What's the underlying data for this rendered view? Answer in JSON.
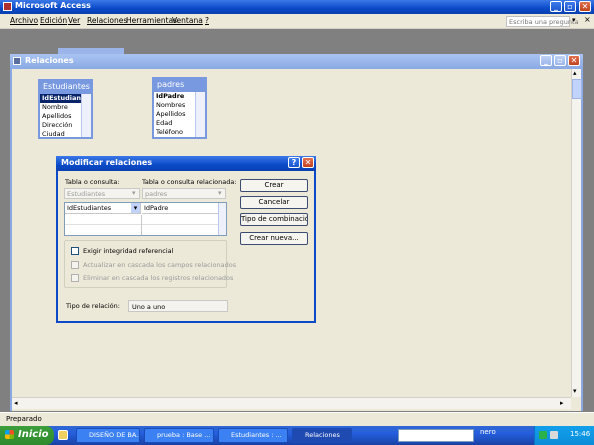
{
  "app": {
    "title": "Microsoft Access"
  },
  "menu": {
    "items": [
      "Archivo",
      "Edición",
      "Ver",
      "Relaciones",
      "Herramientas",
      "Ventana",
      "?"
    ],
    "help_placeholder": "Escriba una pregunta"
  },
  "relations_window": {
    "title": "Relaciones"
  },
  "tables": [
    {
      "name": "Estudiantes",
      "fields": [
        "IdEstudiantes",
        "Nombre",
        "Apellidos",
        "Dirección",
        "Ciudad"
      ]
    },
    {
      "name": "padres",
      "fields": [
        "IdPadre",
        "Nombres",
        "Apellidos",
        "Edad",
        "Teléfono"
      ]
    }
  ],
  "dialog": {
    "title": "Modificar relaciones",
    "table_label": "Tabla o consulta:",
    "related_label": "Tabla o consulta relacionada:",
    "table_value": "Estudiantes",
    "related_value": "padres",
    "grid_left": "IdEstudiantes",
    "grid_right": "IdPadre",
    "buttons": [
      "Crear",
      "Cancelar",
      "Tipo de combinación...",
      "Crear nueva..."
    ],
    "enforce_label": "Exigir integridad referencial",
    "cascade_update_label": "Actualizar en cascada los campos relacionados",
    "cascade_delete_label": "Eliminar en cascada los registros relacionados",
    "relation_type_label": "Tipo de relación:",
    "relation_type_value": "Uno a uno"
  },
  "status": {
    "text": "Preparado"
  },
  "taskbar": {
    "start_label": "Inicio",
    "tasks": [
      "DISEÑO DE BA...",
      "prueba : Base ...",
      "Estudiantes : ...",
      "Relaciones"
    ],
    "clock": "15:46",
    "nero_label": "nero"
  },
  "colors": {
    "title_blue": "#0A4AC8",
    "inactive_blue": "#8AA9E4",
    "taskbar_blue": "#245EDC",
    "start_green": "#2E8A2E"
  }
}
